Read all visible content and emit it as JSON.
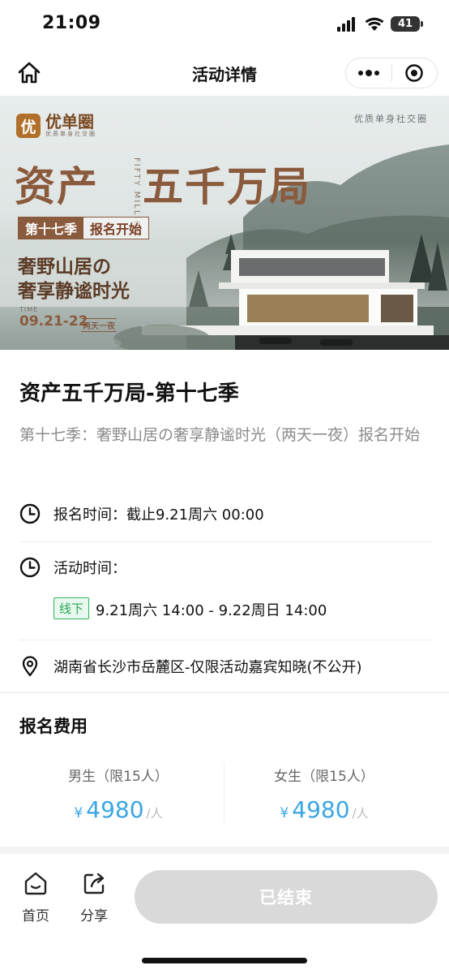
{
  "status_bar": {
    "time": "21:09",
    "battery": "41"
  },
  "nav": {
    "title": "活动详情",
    "home_icon": "home-icon",
    "more_icon": "more-dots-icon",
    "close_icon": "target-close-icon"
  },
  "banner": {
    "brand_logo": "优",
    "brand_name": "优单圈",
    "brand_sub": "优质单身社交圈",
    "brand_right": "优质单身社交圈",
    "title_a": "资产",
    "vertical_text": "FIFTY MILLION",
    "title_b": "五千万局",
    "season": "第十七季",
    "signup": "报名开始",
    "slogan_line1": "奢野山居の",
    "slogan_line2": "奢享静谧时光",
    "time_label": "TIME",
    "time_date": "09.21-22",
    "time_badge": "两天一夜"
  },
  "event": {
    "title": "资产五千万局-第十七季",
    "description": "第十七季：奢野山居の奢享静谧时光（两天一夜）报名开始"
  },
  "info": {
    "signup_time": "报名时间：截止9.21周六 00:00",
    "activity_time_label": "活动时间：",
    "offline_tag": "线下",
    "activity_time": "9.21周六 14:00 - 9.22周日 14:00",
    "location": "湖南省长沙市岳麓区-仅限活动嘉宾知晓(不公开)"
  },
  "fees": {
    "heading": "报名费用",
    "items": [
      {
        "label": "男生（限15人）",
        "currency": "¥",
        "amount": "4980",
        "unit": "/人"
      },
      {
        "label": "女生（限15人）",
        "currency": "¥",
        "amount": "4980",
        "unit": "/人"
      }
    ]
  },
  "bottom_bar": {
    "home_label": "首页",
    "share_label": "分享",
    "action_label": "已结束"
  },
  "colors": {
    "price": "#3aa6e3",
    "offline_tag": "#25a853",
    "banner_title": "#8a5a3c",
    "disabled_button": "#d9d9d9"
  }
}
